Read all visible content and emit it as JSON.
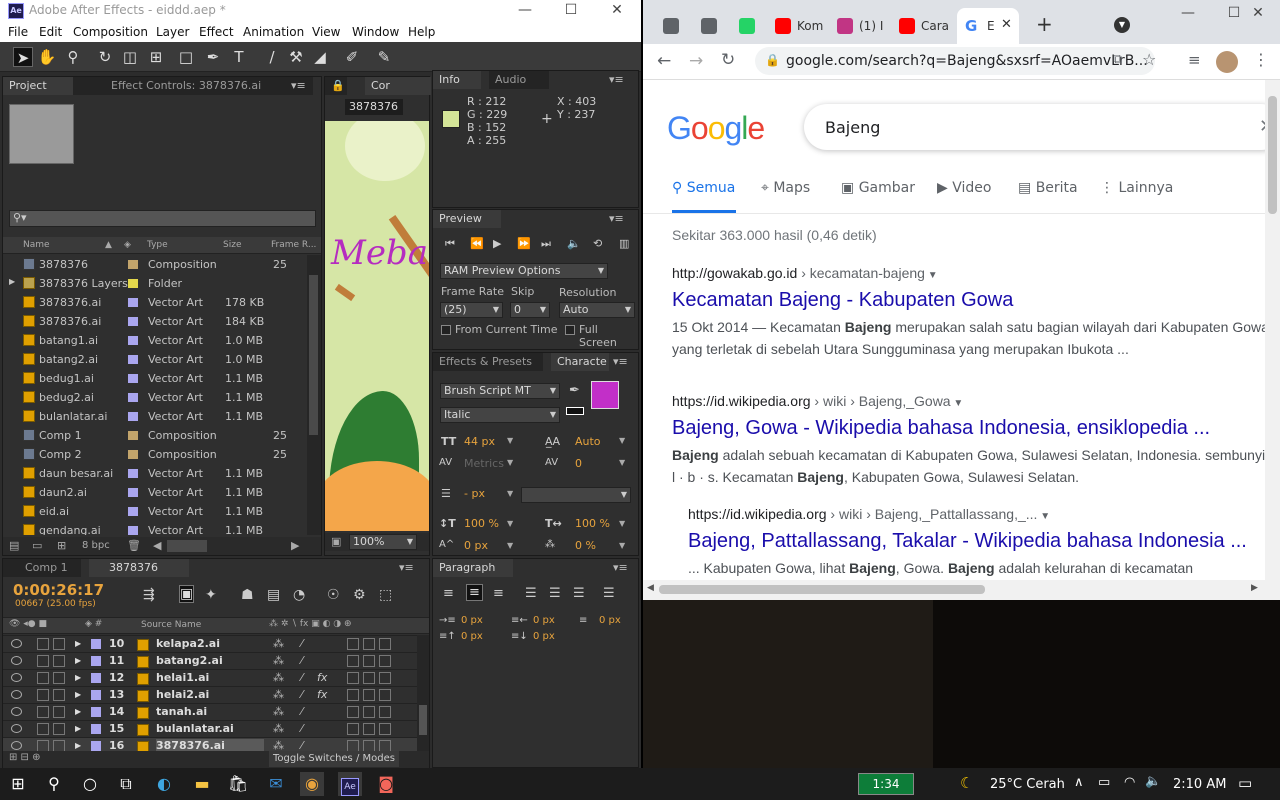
{
  "ae": {
    "title": "Adobe After Effects - eiddd.aep *",
    "logo": "Ae",
    "window_controls": [
      "—",
      "☐",
      "✕"
    ],
    "menu": [
      "File",
      "Edit",
      "Composition",
      "Layer",
      "Effect",
      "Animation",
      "View",
      "Window",
      "Help"
    ],
    "project_panel": {
      "tab_project": "Project",
      "tab_effect_controls": "Effect Controls: 3878376.ai",
      "search_placeholder": "",
      "columns": {
        "name": "Name",
        "type": "Type",
        "size": "Size",
        "frame_rate": "Frame R..."
      },
      "items": [
        {
          "name": "3878376",
          "type": "Composition",
          "size": "",
          "fr": "25",
          "kind": "comp",
          "label": "#c2a46b"
        },
        {
          "name": "3878376 Layers",
          "type": "Folder",
          "size": "",
          "fr": "",
          "kind": "folder",
          "label": "#e4d84c"
        },
        {
          "name": "3878376.ai",
          "type": "Vector Art",
          "size": "178 KB",
          "fr": "",
          "kind": "ai",
          "label": "#aaa6ef"
        },
        {
          "name": "3878376.ai",
          "type": "Vector Art",
          "size": "184 KB",
          "fr": "",
          "kind": "ai",
          "label": "#aaa6ef"
        },
        {
          "name": "batang1.ai",
          "type": "Vector Art",
          "size": "1.0 MB",
          "fr": "",
          "kind": "ai",
          "label": "#aaa6ef"
        },
        {
          "name": "batang2.ai",
          "type": "Vector Art",
          "size": "1.0 MB",
          "fr": "",
          "kind": "ai",
          "label": "#aaa6ef"
        },
        {
          "name": "bedug1.ai",
          "type": "Vector Art",
          "size": "1.1 MB",
          "fr": "",
          "kind": "ai",
          "label": "#aaa6ef"
        },
        {
          "name": "bedug2.ai",
          "type": "Vector Art",
          "size": "1.1 MB",
          "fr": "",
          "kind": "ai",
          "label": "#aaa6ef"
        },
        {
          "name": "bulanlatar.ai",
          "type": "Vector Art",
          "size": "1.1 MB",
          "fr": "",
          "kind": "ai",
          "label": "#aaa6ef"
        },
        {
          "name": "Comp 1",
          "type": "Composition",
          "size": "",
          "fr": "25",
          "kind": "comp",
          "label": "#c2a46b"
        },
        {
          "name": "Comp 2",
          "type": "Composition",
          "size": "",
          "fr": "25",
          "kind": "comp",
          "label": "#c2a46b"
        },
        {
          "name": "daun besar.ai",
          "type": "Vector Art",
          "size": "1.1 MB",
          "fr": "",
          "kind": "ai",
          "label": "#aaa6ef"
        },
        {
          "name": "daun2.ai",
          "type": "Vector Art",
          "size": "1.1 MB",
          "fr": "",
          "kind": "ai",
          "label": "#aaa6ef"
        },
        {
          "name": "eid.ai",
          "type": "Vector Art",
          "size": "1.1 MB",
          "fr": "",
          "kind": "ai",
          "label": "#aaa6ef"
        },
        {
          "name": "gendang.ai",
          "type": "Vector Art",
          "size": "1.1 MB",
          "fr": "",
          "kind": "ai",
          "label": "#aaa6ef"
        }
      ],
      "bpc": "8 bpc"
    },
    "comp_viewer": {
      "tab": "Cor",
      "comp_name": "3878376",
      "zoom": "100%",
      "preview_text": "Meba"
    },
    "info_panel": {
      "tab_info": "Info",
      "tab_audio": "Audio",
      "swatch": "#d4e598",
      "r": "R : 212",
      "g": "G : 229",
      "b": "B : 152",
      "a": "A : 255",
      "x": "X : 403",
      "y": "Y : 237"
    },
    "preview_panel": {
      "tab": "Preview",
      "ram_preview": "RAM Preview Options",
      "frame_rate_label": "Frame Rate",
      "skip_label": "Skip",
      "resolution_label": "Resolution",
      "frame_rate": "(25)",
      "skip": "0",
      "resolution": "Auto",
      "from_current_time": "From Current Time",
      "full_screen": "Full Screen"
    },
    "character_panel": {
      "tab_effects": "Effects & Presets",
      "tab_character": "Characte",
      "font": "Brush Script MT",
      "style": "Italic",
      "fill_color": "#c22fc8",
      "size": "44 px",
      "leading": "Auto",
      "kerning": "Metrics",
      "tracking": "0",
      "stroke": "- px",
      "vscale": "100 %",
      "hscale": "100 %",
      "baseline": "0 px",
      "tsume": "0 %"
    },
    "paragraph_panel": {
      "tab": "Paragraph",
      "indent_left": "0 px",
      "indent_right": "0 px",
      "indent_first": "0 px",
      "space_before": "0 px",
      "space_after": "0 px"
    },
    "timeline": {
      "tab_comp1": "Comp 1",
      "tab_active": "3878376",
      "timecode": "0:00:26:17",
      "frames": "00667 (25.00 fps)",
      "col_source": "Source Name",
      "toggle": "Toggle Switches / Modes",
      "layers": [
        {
          "num": "10",
          "name": "kelapa2.ai",
          "fx": ""
        },
        {
          "num": "11",
          "name": "batang2.ai",
          "fx": ""
        },
        {
          "num": "12",
          "name": "helai1.ai",
          "fx": "fx"
        },
        {
          "num": "13",
          "name": "helai2.ai",
          "fx": "fx"
        },
        {
          "num": "14",
          "name": "tanah.ai",
          "fx": ""
        },
        {
          "num": "15",
          "name": "bulanlatar.ai",
          "fx": ""
        },
        {
          "num": "16",
          "name": "3878376.ai",
          "fx": ""
        }
      ]
    }
  },
  "chrome": {
    "tabs": [
      {
        "label": "",
        "icon": "globe-icon",
        "color": "#5f6368"
      },
      {
        "label": "",
        "icon": "globe-icon",
        "color": "#5f6368"
      },
      {
        "label": "",
        "icon": "whatsapp-icon",
        "color": "#25d366"
      },
      {
        "label": "Kom",
        "icon": "youtube-icon",
        "color": "#ff0000"
      },
      {
        "label": "(1) I",
        "icon": "instagram-icon",
        "color": "#c13584"
      },
      {
        "label": "Cara",
        "icon": "youtube-icon",
        "color": "#ff0000"
      }
    ],
    "active_tab": {
      "label": "E",
      "icon": "google-icon"
    },
    "new_tab": "+",
    "url": "google.com/search?q=Bajeng&sxsrf=AOaemvLrB...",
    "window_controls": [
      "—",
      "☐",
      "✕"
    ],
    "google": {
      "logo": [
        "G",
        "o",
        "o",
        "g",
        "l",
        "e"
      ],
      "logo_colors": [
        "#4285f4",
        "#ea4335",
        "#fbbc05",
        "#4285f4",
        "#34a853",
        "#ea4335"
      ],
      "query": "Bajeng",
      "nav": [
        "Semua",
        "Maps",
        "Gambar",
        "Video",
        "Berita",
        "Lainnya"
      ],
      "stats": "Sekitar 363.000 hasil (0,46 detik)",
      "results": [
        {
          "cite_domain": "http://gowakab.go.id",
          "cite_path": " › kecamatan-bajeng",
          "title": "Kecamatan Bajeng - Kabupaten Gowa",
          "snippet_1": "15 Okt 2014 — Kecamatan Bajeng merupakan salah satu bagian wilayah dari Kabupaten Gowa",
          "snippet_2": "yang terletak di sebelah Utara Sungguminasa yang merupakan Ibukota ..."
        },
        {
          "cite_domain": "https://id.wikipedia.org",
          "cite_path": " › wiki › Bajeng,_Gowa",
          "title": "Bajeng, Gowa - Wikipedia bahasa Indonesia, ensiklopedia ...",
          "snippet_1": "Bajeng adalah sebuah kecamatan di Kabupaten Gowa, Sulawesi Selatan, Indonesia. sembunyi",
          "snippet_2": "l · b · s. Kecamatan Bajeng, Kabupaten Gowa, Sulawesi Selatan."
        },
        {
          "cite_domain": "https://id.wikipedia.org",
          "cite_path": " › wiki › Bajeng,_Pattallassang,_...",
          "title": "Bajeng, Pattallassang, Takalar - Wikipedia bahasa Indonesia ...",
          "snippet_1": "... Kabupaten Gowa, lihat Bajeng, Gowa. Bajeng adalah kelurahan di kecamatan",
          "snippet_2": ""
        }
      ]
    }
  },
  "taskbar": {
    "clock_badge": "1:34",
    "weather": "25°C Cerah",
    "time": "2:10 AM",
    "apps": [
      "windows-icon",
      "search-icon",
      "cortana-icon",
      "task-view-icon",
      "edge-icon",
      "file-explorer-icon",
      "store-icon",
      "mail-icon",
      "chrome-icon",
      "after-effects-icon",
      "app-icon"
    ]
  }
}
